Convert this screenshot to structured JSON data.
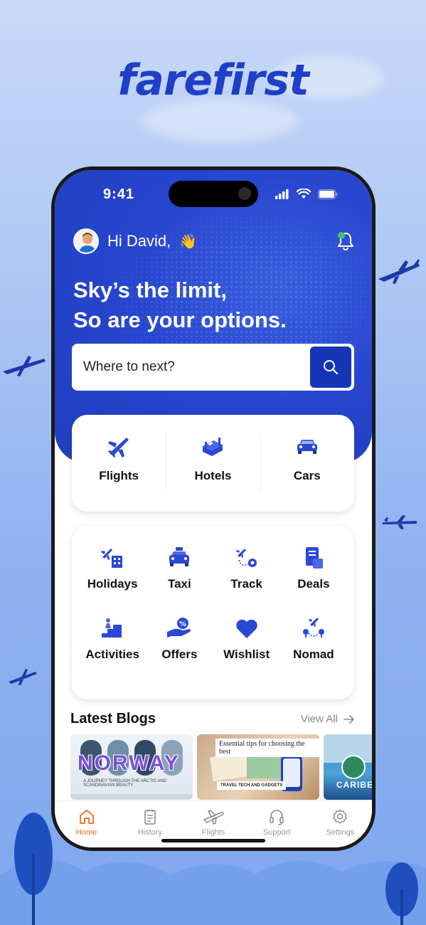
{
  "brand": {
    "name": "farefirst"
  },
  "status_bar": {
    "time": "9:41"
  },
  "header": {
    "greeting": "Hi David,",
    "wave_emoji": "👋"
  },
  "hero": {
    "line1": "Sky’s the limit,",
    "line2": "So are your options."
  },
  "search": {
    "placeholder": "Where to next?"
  },
  "main_services": [
    {
      "label": "Flights",
      "icon": "airplane-icon"
    },
    {
      "label": "Hotels",
      "icon": "hotel-bed-icon"
    },
    {
      "label": "Cars",
      "icon": "car-icon"
    }
  ],
  "more_services": [
    {
      "label": "Holidays",
      "icon": "holidays-icon"
    },
    {
      "label": "Taxi",
      "icon": "taxi-icon"
    },
    {
      "label": "Track",
      "icon": "track-icon"
    },
    {
      "label": "Deals",
      "icon": "deals-icon"
    },
    {
      "label": "Activities",
      "icon": "activities-icon"
    },
    {
      "label": "Offers",
      "icon": "offers-icon"
    },
    {
      "label": "Wishlist",
      "icon": "heart-icon"
    },
    {
      "label": "Nomad",
      "icon": "nomad-icon"
    }
  ],
  "blogs": {
    "title": "Latest Blogs",
    "view_all": "View All",
    "items": [
      {
        "headline": "NORWAY",
        "subtitle": "A JOURNEY THROUGH THE ARCTIC AND SCANDINAVIAN BEAUTY"
      },
      {
        "headline": "Essential tips for choosing the best",
        "subtitle": "TRAVEL TECH AND GADGETS"
      },
      {
        "headline": "CARIBE"
      }
    ]
  },
  "tabbar": {
    "tabs": [
      {
        "label": "Home",
        "icon": "home-icon",
        "active": true
      },
      {
        "label": "History",
        "icon": "history-icon",
        "active": false
      },
      {
        "label": "Flights",
        "icon": "airplane-icon",
        "active": false
      },
      {
        "label": "Support",
        "icon": "headset-icon",
        "active": false
      },
      {
        "label": "Settings",
        "icon": "gear-icon",
        "active": false
      }
    ]
  },
  "colors": {
    "primary": "#1f3ec8",
    "accent_active_tab": "#ef6a1b",
    "notification_dot": "#3ac46a"
  }
}
